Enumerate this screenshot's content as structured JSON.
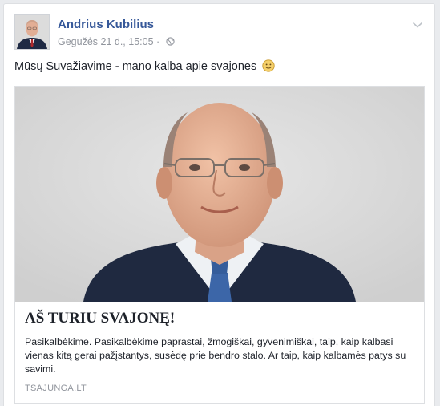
{
  "post": {
    "author": "Andrius Kubilius",
    "date": "Gegužės 21 d., 15:05",
    "separator": "·",
    "privacy_icon": "globe-icon",
    "menu_icon": "chevron-down-icon",
    "text": "Mūsų Suvažiavime - mano kalba apie svajones",
    "emoji": "smile-emoji-icon"
  },
  "link_preview": {
    "image": "portrait-photo",
    "title": "AŠ TURIU SVAJONĘ!",
    "description": "Pasikalbėkime. Pasikalbėkime paprastai, žmogiškai, gyvenimiškai, taip, kaip kalbasi vienas kitą gerai pažįstantys, susėdę prie bendro stalo. Ar taip, kaip kalbamės patys su savimi.",
    "domain": "TSAJUNGA.LT"
  },
  "colors": {
    "author_link": "#365899",
    "meta_text": "#90949c",
    "body_text": "#1d2129",
    "page_bg": "#e9ebee"
  }
}
